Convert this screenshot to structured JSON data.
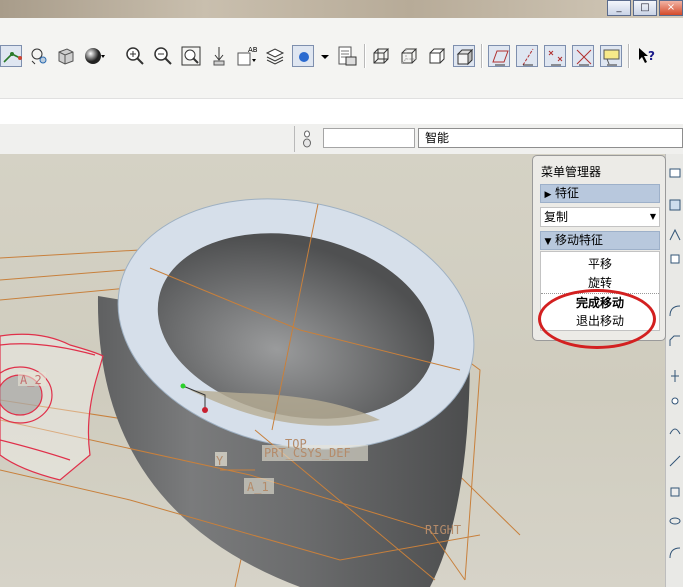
{
  "window_controls": {
    "minimize": "_",
    "restore": "□",
    "close": "×"
  },
  "toolbar": {
    "icons": [
      "spin-center-icon",
      "orient-icon",
      "view-manager-icon",
      "shading-icon",
      "zoom-in-icon",
      "zoom-out-icon",
      "refit-icon",
      "repaint-icon",
      "saved-views-icon",
      "layers-icon",
      "display-style-icon",
      "model-tree-icon",
      "wireframe-icon",
      "hidden-line-icon",
      "no-hidden-icon",
      "shaded-icon",
      "datum-planes-icon",
      "datum-axes-icon",
      "datum-points-icon",
      "coordinate-systems-icon",
      "annotations-icon",
      "context-help-icon"
    ]
  },
  "filter": {
    "value": "智能"
  },
  "menu_manager": {
    "title": "菜单管理器",
    "feature_header": "特征",
    "copy_value": "复制",
    "move_header": "移动特征",
    "items": [
      "平移",
      "旋转",
      "完成移动",
      "退出移动"
    ],
    "highlight_color": "#d32020"
  },
  "viewport_labels": {
    "top_plane": "TOP",
    "csys": "PRT_CSYS_DEF",
    "y_axis": "Y",
    "axis_a1": "A_1",
    "right_plane": "RIGHT",
    "axis_a2": "A_2"
  },
  "colors": {
    "model_gray": "#6e6f70",
    "datum_orange": "#c8803c",
    "selected_red": "#e0304a"
  }
}
